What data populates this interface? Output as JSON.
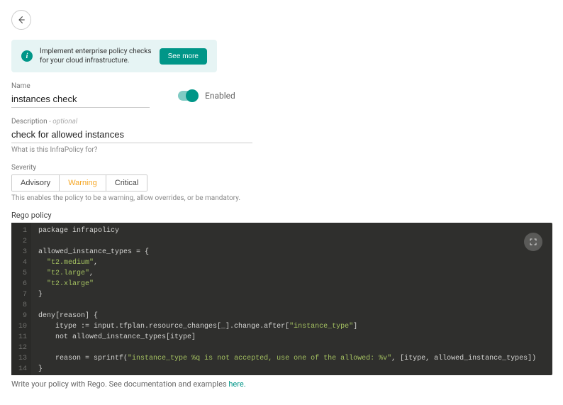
{
  "banner": {
    "text": "Implement enterprise policy checks for your cloud infrastructure.",
    "button": "See more"
  },
  "name_field": {
    "label": "Name",
    "value": "instances check"
  },
  "enabled": {
    "label": "Enabled",
    "on": true
  },
  "description_field": {
    "label": "Description",
    "optional_suffix": " - optional",
    "value": "check for allowed instances",
    "helper": "What is this InfraPolicy for?"
  },
  "severity": {
    "label": "Severity",
    "options": [
      "Advisory",
      "Warning",
      "Critical"
    ],
    "selected": "Warning",
    "helper": "This enables the policy to be a warning, allow overrides, or be mandatory."
  },
  "rego": {
    "label": "Rego policy",
    "lines": [
      "package infrapolicy",
      "",
      "allowed_instance_types = {",
      "  \"t2.medium\",",
      "  \"t2.large\",",
      "  \"t2.xlarge\"",
      "}",
      "",
      "deny[reason] {",
      "    itype := input.tfplan.resource_changes[_].change.after[\"instance_type\"]",
      "    not allowed_instance_types[itype]",
      "",
      "    reason = sprintf(\"instance_type %q is not accepted, use one of the allowed: %v\", [itype, allowed_instance_types])",
      "}"
    ]
  },
  "footer": {
    "text": "Write your policy with Rego. See documentation and examples ",
    "link": "here."
  }
}
